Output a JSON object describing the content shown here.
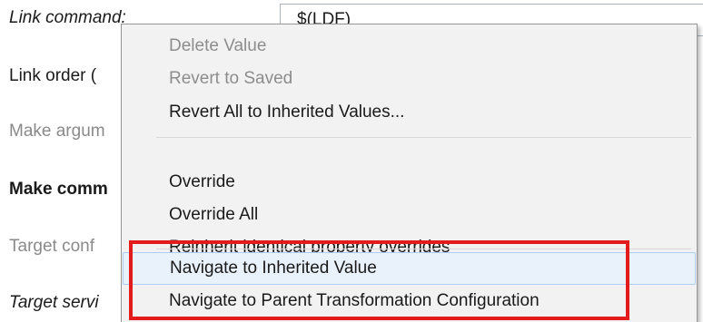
{
  "properties": {
    "link_command_label": "Link command:",
    "link_command_value": "$(LDF)",
    "link_order_label": "Link order (",
    "make_arguments_label": "Make argum",
    "make_command_label": "Make comm",
    "target_config_label": "Target conf",
    "target_service_label": "Target servi"
  },
  "context_menu": {
    "items": [
      {
        "label": "Delete Value",
        "enabled": false
      },
      {
        "label": "Revert to Saved",
        "enabled": false
      },
      {
        "label": "Revert All to Inherited Values...",
        "enabled": true
      },
      {
        "label": "Override",
        "enabled": true
      },
      {
        "label": "Override All",
        "enabled": true
      },
      {
        "label": "Reinherit identical property overrides",
        "enabled": true
      },
      {
        "label": "Navigate to Inherited Value",
        "enabled": true,
        "hovered": true
      },
      {
        "label": "Navigate to Parent Transformation Configuration",
        "enabled": true
      }
    ]
  },
  "colors": {
    "highlight_box": "#e41b1b",
    "menu_background": "#f2f2f2",
    "hover_background": "#e9f1fb"
  }
}
